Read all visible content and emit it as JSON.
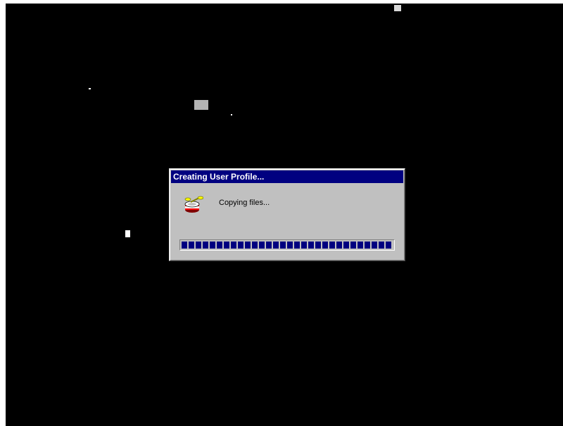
{
  "dialog": {
    "title": "Creating User Profile...",
    "message": "Copying files...",
    "icon": "profile-copy-icon",
    "progress_fraction": 1.0
  },
  "colors": {
    "desktop": "#000000",
    "dialog_face": "#c0c0c0",
    "titlebar": "#000080",
    "progress_segment": "#000080"
  }
}
